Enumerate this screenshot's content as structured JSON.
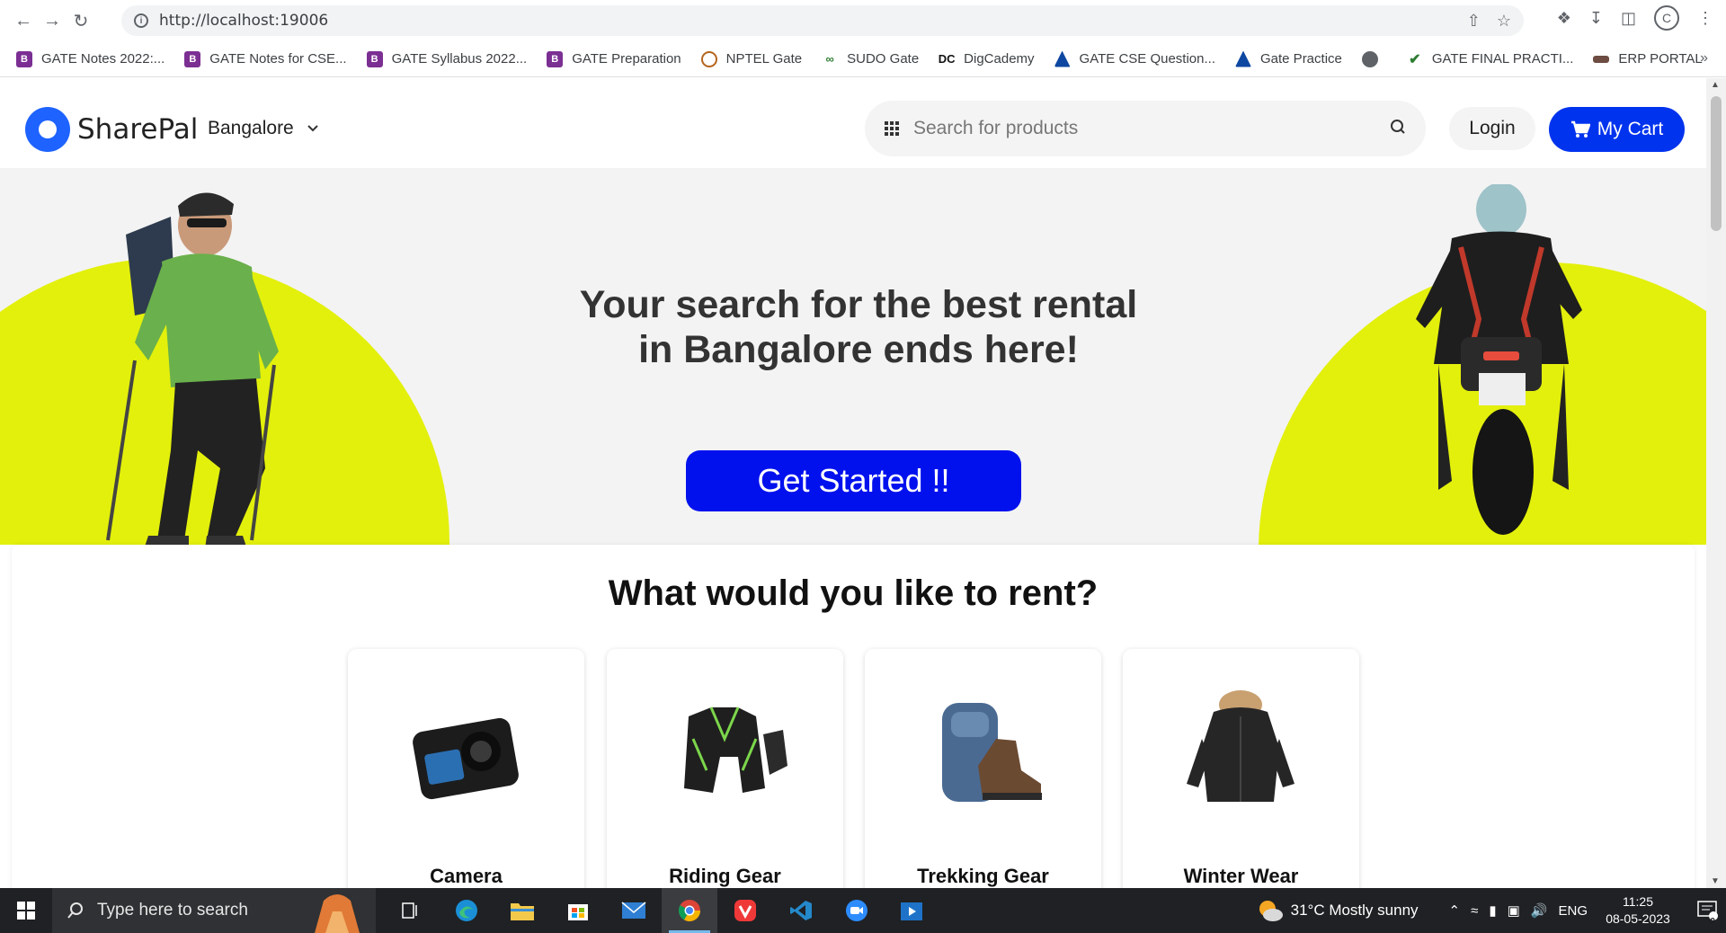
{
  "browser": {
    "url": "http://localhost:19006",
    "profile_initial": "C",
    "bookmarks": [
      {
        "label": "GATE Notes 2022:...",
        "icon": "b-icon",
        "color": "#7b2f93"
      },
      {
        "label": "GATE Notes for CSE...",
        "icon": "b-icon",
        "color": "#7b2f93"
      },
      {
        "label": "GATE Syllabus 2022...",
        "icon": "b-icon",
        "color": "#7b2f93"
      },
      {
        "label": "GATE Preparation",
        "icon": "b-icon",
        "color": "#7b2f93"
      },
      {
        "label": "NPTEL Gate",
        "icon": "nptel-icon",
        "color": "#b5651d"
      },
      {
        "label": "SUDO Gate",
        "icon": "sudo-icon",
        "color": "#2e7d32"
      },
      {
        "label": "DigCademy",
        "icon": "dc-icon",
        "color": "#111111"
      },
      {
        "label": "GATE CSE Question...",
        "icon": "gcq-icon",
        "color": "#0d47a1"
      },
      {
        "label": "Gate Practice",
        "icon": "gp-icon",
        "color": "#0d47a1"
      },
      {
        "label": "",
        "icon": "globe-icon",
        "color": "#5f6368"
      },
      {
        "label": "GATE FINAL PRACTI...",
        "icon": "check-icon",
        "color": "#2e7d32"
      },
      {
        "label": "ERP PORTAL",
        "icon": "erp-icon",
        "color": "#6d4c41"
      }
    ],
    "more_label": "»"
  },
  "header": {
    "brand": "SharePal",
    "city": "Bangalore",
    "search_placeholder": "Search for products",
    "login_label": "Login",
    "cart_label": "My Cart"
  },
  "hero": {
    "title": "Your search for the best rental in Bangalore ends here!",
    "cta_label": "Get Started !!",
    "accent_color": "#e3f00b",
    "cta_color": "#0011ee"
  },
  "rent": {
    "title": "What would you like to rent?",
    "categories": [
      {
        "label": "Camera",
        "icon": "action-camera-icon"
      },
      {
        "label": "Riding Gear",
        "icon": "riding-jacket-icon"
      },
      {
        "label": "Trekking Gear",
        "icon": "backpack-boot-icon"
      },
      {
        "label": "Winter Wear",
        "icon": "winter-jacket-icon"
      }
    ]
  },
  "taskbar": {
    "search_placeholder": "Type here to search",
    "weather": "31°C  Mostly sunny",
    "language": "ENG",
    "time": "11:25",
    "date": "08-05-2023",
    "notification_count": "10"
  }
}
